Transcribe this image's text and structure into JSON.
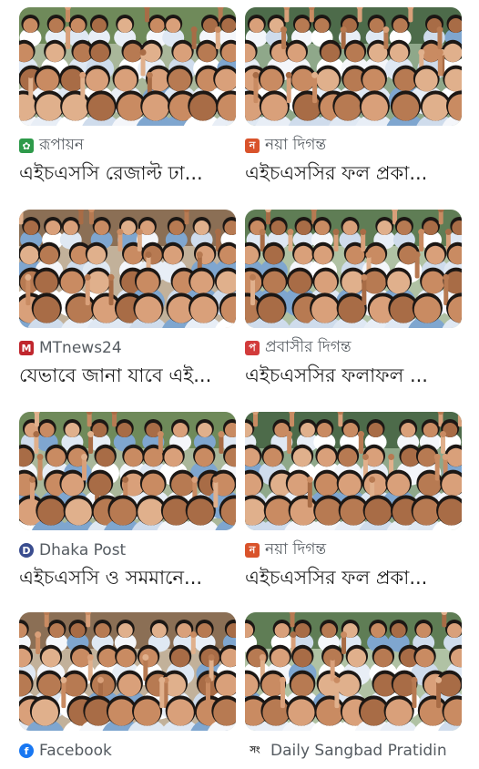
{
  "cards": [
    {
      "source": "রূপায়ন",
      "icon": "rupayan-logo-icon",
      "icon_color": "#2e9a4a",
      "icon_glyph": "✿",
      "headline": "এইচএসসি রেজাল্ট ঢা...",
      "image": "students-celebrating-photo"
    },
    {
      "source": "নয়া দিগন্ত",
      "icon": "naya-diganta-logo-icon",
      "icon_color": "#d9532b",
      "icon_glyph": "ন",
      "headline": "এইচএসসির ফল প্রকা...",
      "image": "students-celebrating-photo"
    },
    {
      "source": "MTnews24",
      "icon": "mtnews24-logo-icon",
      "icon_color": "#c0262d",
      "icon_glyph": "M",
      "headline": "যেভাবে জানা যাবে এই...",
      "image": "students-celebrating-photo"
    },
    {
      "source": "প্রবাসীর দিগন্ত",
      "icon": "probashir-diganta-logo-icon",
      "icon_color": "#d23b3b",
      "icon_glyph": "প",
      "headline": "এইচএসসির ফলাফল ...",
      "image": "students-celebrating-photo"
    },
    {
      "source": "Dhaka Post",
      "icon": "dhaka-post-logo-icon",
      "icon_color": "#3a4d8f",
      "icon_glyph": "D",
      "headline": "এইচএসসি ও সমমানে...",
      "image": "students-celebrating-photo"
    },
    {
      "source": "নয়া দিগন্ত",
      "icon": "naya-diganta-logo-icon",
      "icon_color": "#d9532b",
      "icon_glyph": "ন",
      "headline": "এইচএসসির ফল প্রকা...",
      "image": "students-celebrating-photo"
    },
    {
      "source": "Facebook",
      "icon": "facebook-logo-icon",
      "icon_color": "#1877f2",
      "icon_glyph": "f",
      "headline": "",
      "image": "students-celebrating-photo"
    },
    {
      "source": "Daily Sangbad Pratidin",
      "icon": "sangbad-pratidin-logo-icon",
      "icon_color": "#222222",
      "icon_glyph": "সং",
      "headline": "",
      "image": "students-celebrating-photo"
    }
  ]
}
